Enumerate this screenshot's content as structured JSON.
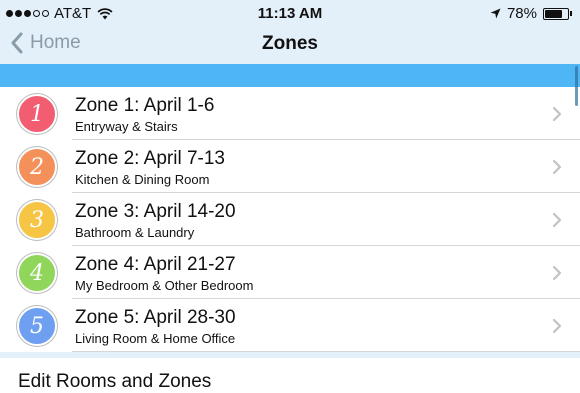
{
  "status_bar": {
    "signal_filled": 3,
    "signal_empty": 2,
    "carrier": "AT&T",
    "time": "11:13 AM",
    "battery_text": "78%",
    "battery_level": 0.78,
    "icons": [
      "wifi-icon",
      "location-arrow-icon",
      "battery-icon"
    ]
  },
  "nav": {
    "back_label": "Home",
    "title": "Zones"
  },
  "colors": {
    "bar_background": "#e3f0fa",
    "section_header": "#4fb6f5",
    "back_tint": "#8a9ba8"
  },
  "zones": [
    {
      "number": "1",
      "title": "Zone 1: April 1-6",
      "subtitle": "Entryway & Stairs",
      "color": "#f25d72"
    },
    {
      "number": "2",
      "title": "Zone 2: April 7-13",
      "subtitle": "Kitchen & Dining Room",
      "color": "#f4905a"
    },
    {
      "number": "3",
      "title": "Zone 3: April 14-20",
      "subtitle": "Bathroom & Laundry",
      "color": "#f6c544"
    },
    {
      "number": "4",
      "title": "Zone 4: April 21-27",
      "subtitle": "My Bedroom & Other Bedroom",
      "color": "#8fd65a"
    },
    {
      "number": "5",
      "title": "Zone 5: April 28-30",
      "subtitle": "Living Room & Home Office",
      "color": "#6e9ff0"
    }
  ],
  "footer": {
    "edit_label": "Edit Rooms and Zones"
  }
}
